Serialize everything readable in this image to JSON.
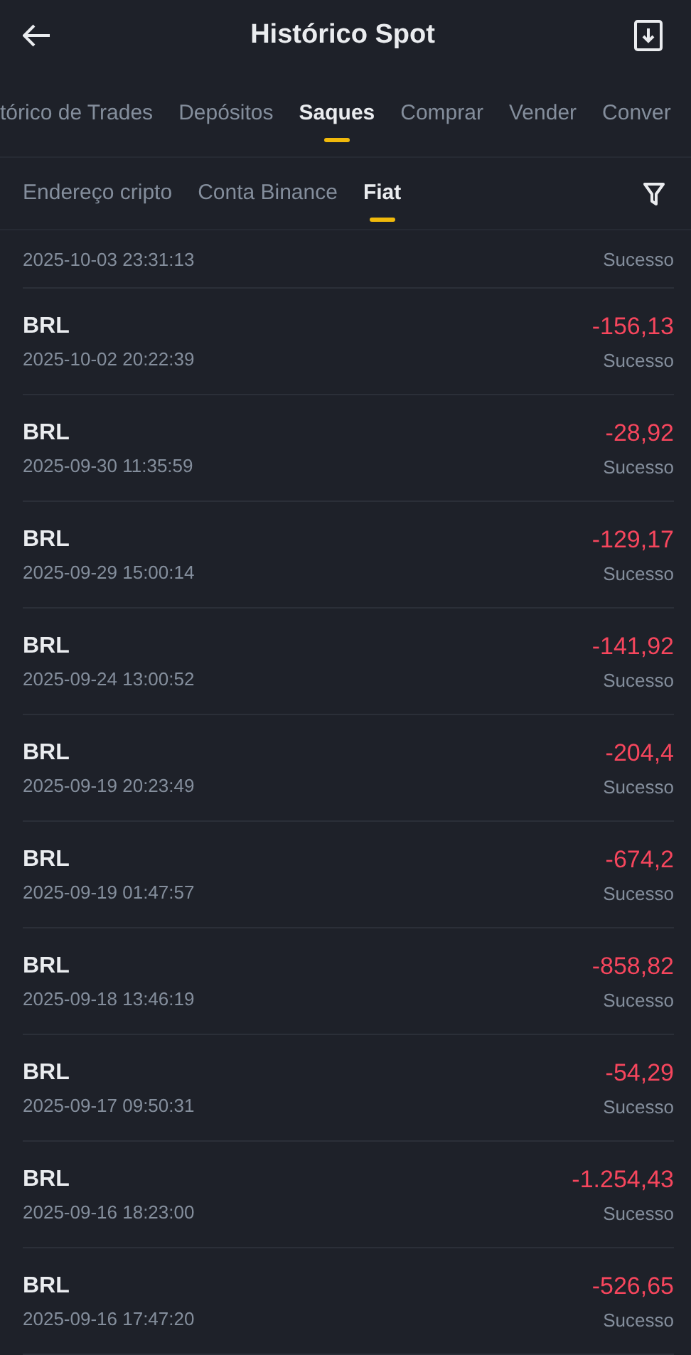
{
  "header": {
    "title": "Histórico Spot"
  },
  "tabs": [
    {
      "label": "tórico de Trades",
      "selected": false
    },
    {
      "label": "Depósitos",
      "selected": false
    },
    {
      "label": "Saques",
      "selected": true
    },
    {
      "label": "Comprar",
      "selected": false
    },
    {
      "label": "Vender",
      "selected": false
    },
    {
      "label": "Conver",
      "selected": false
    }
  ],
  "subtabs": [
    {
      "label": "Endereço cripto",
      "selected": false
    },
    {
      "label": "Conta Binance",
      "selected": false
    },
    {
      "label": "Fiat",
      "selected": true
    }
  ],
  "partial_row": {
    "time": "2025-10-03 23:31:13",
    "status": "Sucesso"
  },
  "rows": [
    {
      "currency": "BRL",
      "time": "2025-10-02 20:22:39",
      "amount": "-156,13",
      "status": "Sucesso"
    },
    {
      "currency": "BRL",
      "time": "2025-09-30 11:35:59",
      "amount": "-28,92",
      "status": "Sucesso"
    },
    {
      "currency": "BRL",
      "time": "2025-09-29 15:00:14",
      "amount": "-129,17",
      "status": "Sucesso"
    },
    {
      "currency": "BRL",
      "time": "2025-09-24 13:00:52",
      "amount": "-141,92",
      "status": "Sucesso"
    },
    {
      "currency": "BRL",
      "time": "2025-09-19 20:23:49",
      "amount": "-204,4",
      "status": "Sucesso"
    },
    {
      "currency": "BRL",
      "time": "2025-09-19 01:47:57",
      "amount": "-674,2",
      "status": "Sucesso"
    },
    {
      "currency": "BRL",
      "time": "2025-09-18 13:46:19",
      "amount": "-858,82",
      "status": "Sucesso"
    },
    {
      "currency": "BRL",
      "time": "2025-09-17 09:50:31",
      "amount": "-54,29",
      "status": "Sucesso"
    },
    {
      "currency": "BRL",
      "time": "2025-09-16 18:23:00",
      "amount": "-1.254,43",
      "status": "Sucesso"
    },
    {
      "currency": "BRL",
      "time": "2025-09-16 17:47:20",
      "amount": "-526,65",
      "status": "Sucesso"
    }
  ]
}
